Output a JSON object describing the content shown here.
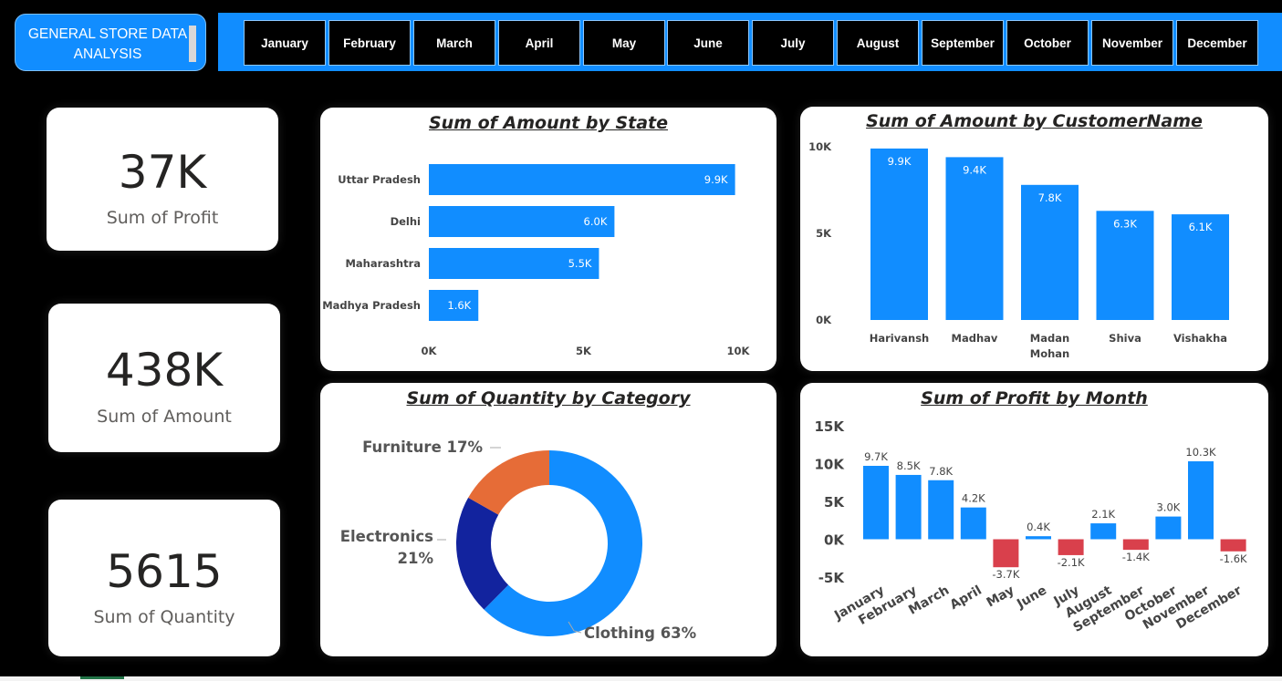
{
  "header": {
    "title_line1": "GENERAL STORE DATA",
    "title_line2": "ANALYSIS"
  },
  "months": [
    "January",
    "February",
    "March",
    "April",
    "May",
    "June",
    "July",
    "August",
    "September",
    "October",
    "November",
    "December"
  ],
  "kpis": {
    "profit": {
      "value": "37K",
      "label": "Sum of Profit"
    },
    "amount": {
      "value": "438K",
      "label": "Sum of Amount"
    },
    "quantity": {
      "value": "5615",
      "label": "Sum of Quantity"
    }
  },
  "colors": {
    "accent": "#118dff",
    "negative": "#d9404c",
    "furniture": "#e66c37",
    "electronics": "#12239e",
    "clothing": "#118dff"
  },
  "chart_data": [
    {
      "id": "state",
      "type": "bar",
      "orientation": "horizontal",
      "title": "Sum of Amount by State",
      "categories": [
        "Uttar Pradesh",
        "Delhi",
        "Maharashtra",
        "Madhya Pradesh"
      ],
      "values": [
        9900,
        6000,
        5500,
        1600
      ],
      "data_labels": [
        "9.9K",
        "6.0K",
        "5.5K",
        "1.6K"
      ],
      "xlim": [
        0,
        10000
      ],
      "xticks": [
        {
          "v": 0,
          "label": "0K"
        },
        {
          "v": 5000,
          "label": "5K"
        },
        {
          "v": 10000,
          "label": "10K"
        }
      ]
    },
    {
      "id": "customer",
      "type": "bar",
      "orientation": "vertical",
      "title": "Sum of Amount by CustomerName",
      "categories": [
        "Harivansh",
        "Madhav",
        "Madan Mohan",
        "Shiva",
        "Vishakha"
      ],
      "values": [
        9900,
        9400,
        7800,
        6300,
        6100
      ],
      "data_labels": [
        "9.9K",
        "9.4K",
        "7.8K",
        "6.3K",
        "6.1K"
      ],
      "ylim": [
        0,
        10000
      ],
      "yticks": [
        {
          "v": 0,
          "label": "0K"
        },
        {
          "v": 5000,
          "label": "5K"
        },
        {
          "v": 10000,
          "label": "10K"
        }
      ]
    },
    {
      "id": "category",
      "type": "pie",
      "donut": true,
      "title": "Sum of Quantity by Category",
      "categories": [
        "Clothing",
        "Electronics",
        "Furniture"
      ],
      "values": [
        63,
        21,
        17
      ],
      "labels": [
        "Clothing 63%",
        "Electronics",
        "Furniture 17%"
      ],
      "sublabels": [
        "",
        "21%",
        ""
      ]
    },
    {
      "id": "month_profit",
      "type": "bar",
      "orientation": "vertical",
      "title": "Sum of Profit by Month",
      "categories": [
        "January",
        "February",
        "March",
        "April",
        "May",
        "June",
        "July",
        "August",
        "September",
        "October",
        "November",
        "December"
      ],
      "values": [
        9700,
        8500,
        7800,
        4200,
        -3700,
        400,
        -2100,
        2100,
        -1400,
        3000,
        10300,
        -1600
      ],
      "data_labels": [
        "9.7K",
        "8.5K",
        "7.8K",
        "4.2K",
        "-3.7K",
        "0.4K",
        "-2.1K",
        "2.1K",
        "-1.4K",
        "3.0K",
        "10.3K",
        "-1.6K"
      ],
      "ylim": [
        -5000,
        15000
      ],
      "yticks": [
        {
          "v": -5000,
          "label": "-5K"
        },
        {
          "v": 0,
          "label": "0K"
        },
        {
          "v": 5000,
          "label": "5K"
        },
        {
          "v": 10000,
          "label": "10K"
        },
        {
          "v": 15000,
          "label": "15K"
        }
      ]
    }
  ]
}
